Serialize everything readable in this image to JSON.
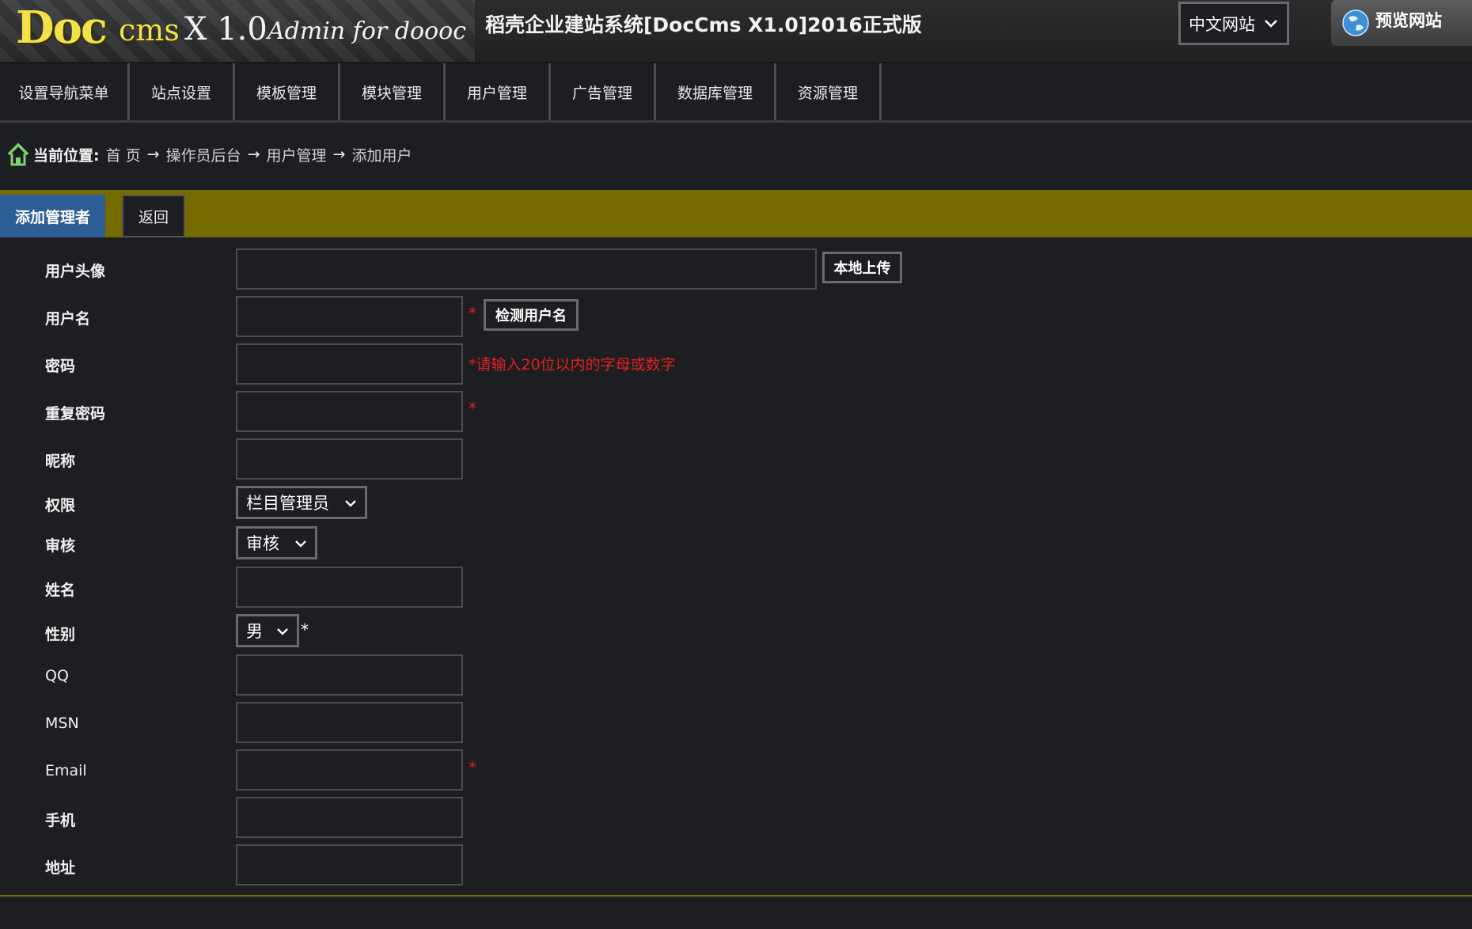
{
  "header": {
    "logo_doc": "Doc",
    "logo_cms": "cms",
    "logo_version": "X 1.0",
    "logo_sub": "Admin for doooc",
    "system_title": "稻壳企业建站系统[DocCms X1.0]2016正式版",
    "lang_select": "中文网站",
    "preview_label": "预览网站"
  },
  "nav": {
    "items": [
      "设置导航菜单",
      "站点设置",
      "模板管理",
      "模块管理",
      "用户管理",
      "广告管理",
      "数据库管理",
      "资源管理"
    ]
  },
  "breadcrumb": {
    "label": "当前位置:",
    "items": [
      "首 页",
      "操作员后台",
      "用户管理",
      "添加用户"
    ],
    "arrow": "→"
  },
  "tabs": {
    "active": "添加管理者",
    "back": "返回"
  },
  "form": {
    "avatar_label": "用户头像",
    "upload_button": "本地上传",
    "username_label": "用户名",
    "check_username_button": "检测用户名",
    "password_label": "密码",
    "password_hint": "*请输入20位以内的字母或数字",
    "repeat_password_label": "重复密码",
    "nickname_label": "昵称",
    "permission_label": "权限",
    "permission_value": "栏目管理员",
    "audit_label": "审核",
    "audit_value": "审核",
    "name_label": "姓名",
    "gender_label": "性别",
    "gender_value": "男",
    "qq_label": "QQ",
    "msn_label": "MSN",
    "email_label": "Email",
    "phone_label": "手机",
    "address_label": "地址",
    "required_mark": "*"
  },
  "colors": {
    "background": "#1c1e21",
    "tabstrip": "#766b00",
    "active_tab": "#2e5e96",
    "required": "#e02020",
    "logo": "#f3e04a"
  }
}
